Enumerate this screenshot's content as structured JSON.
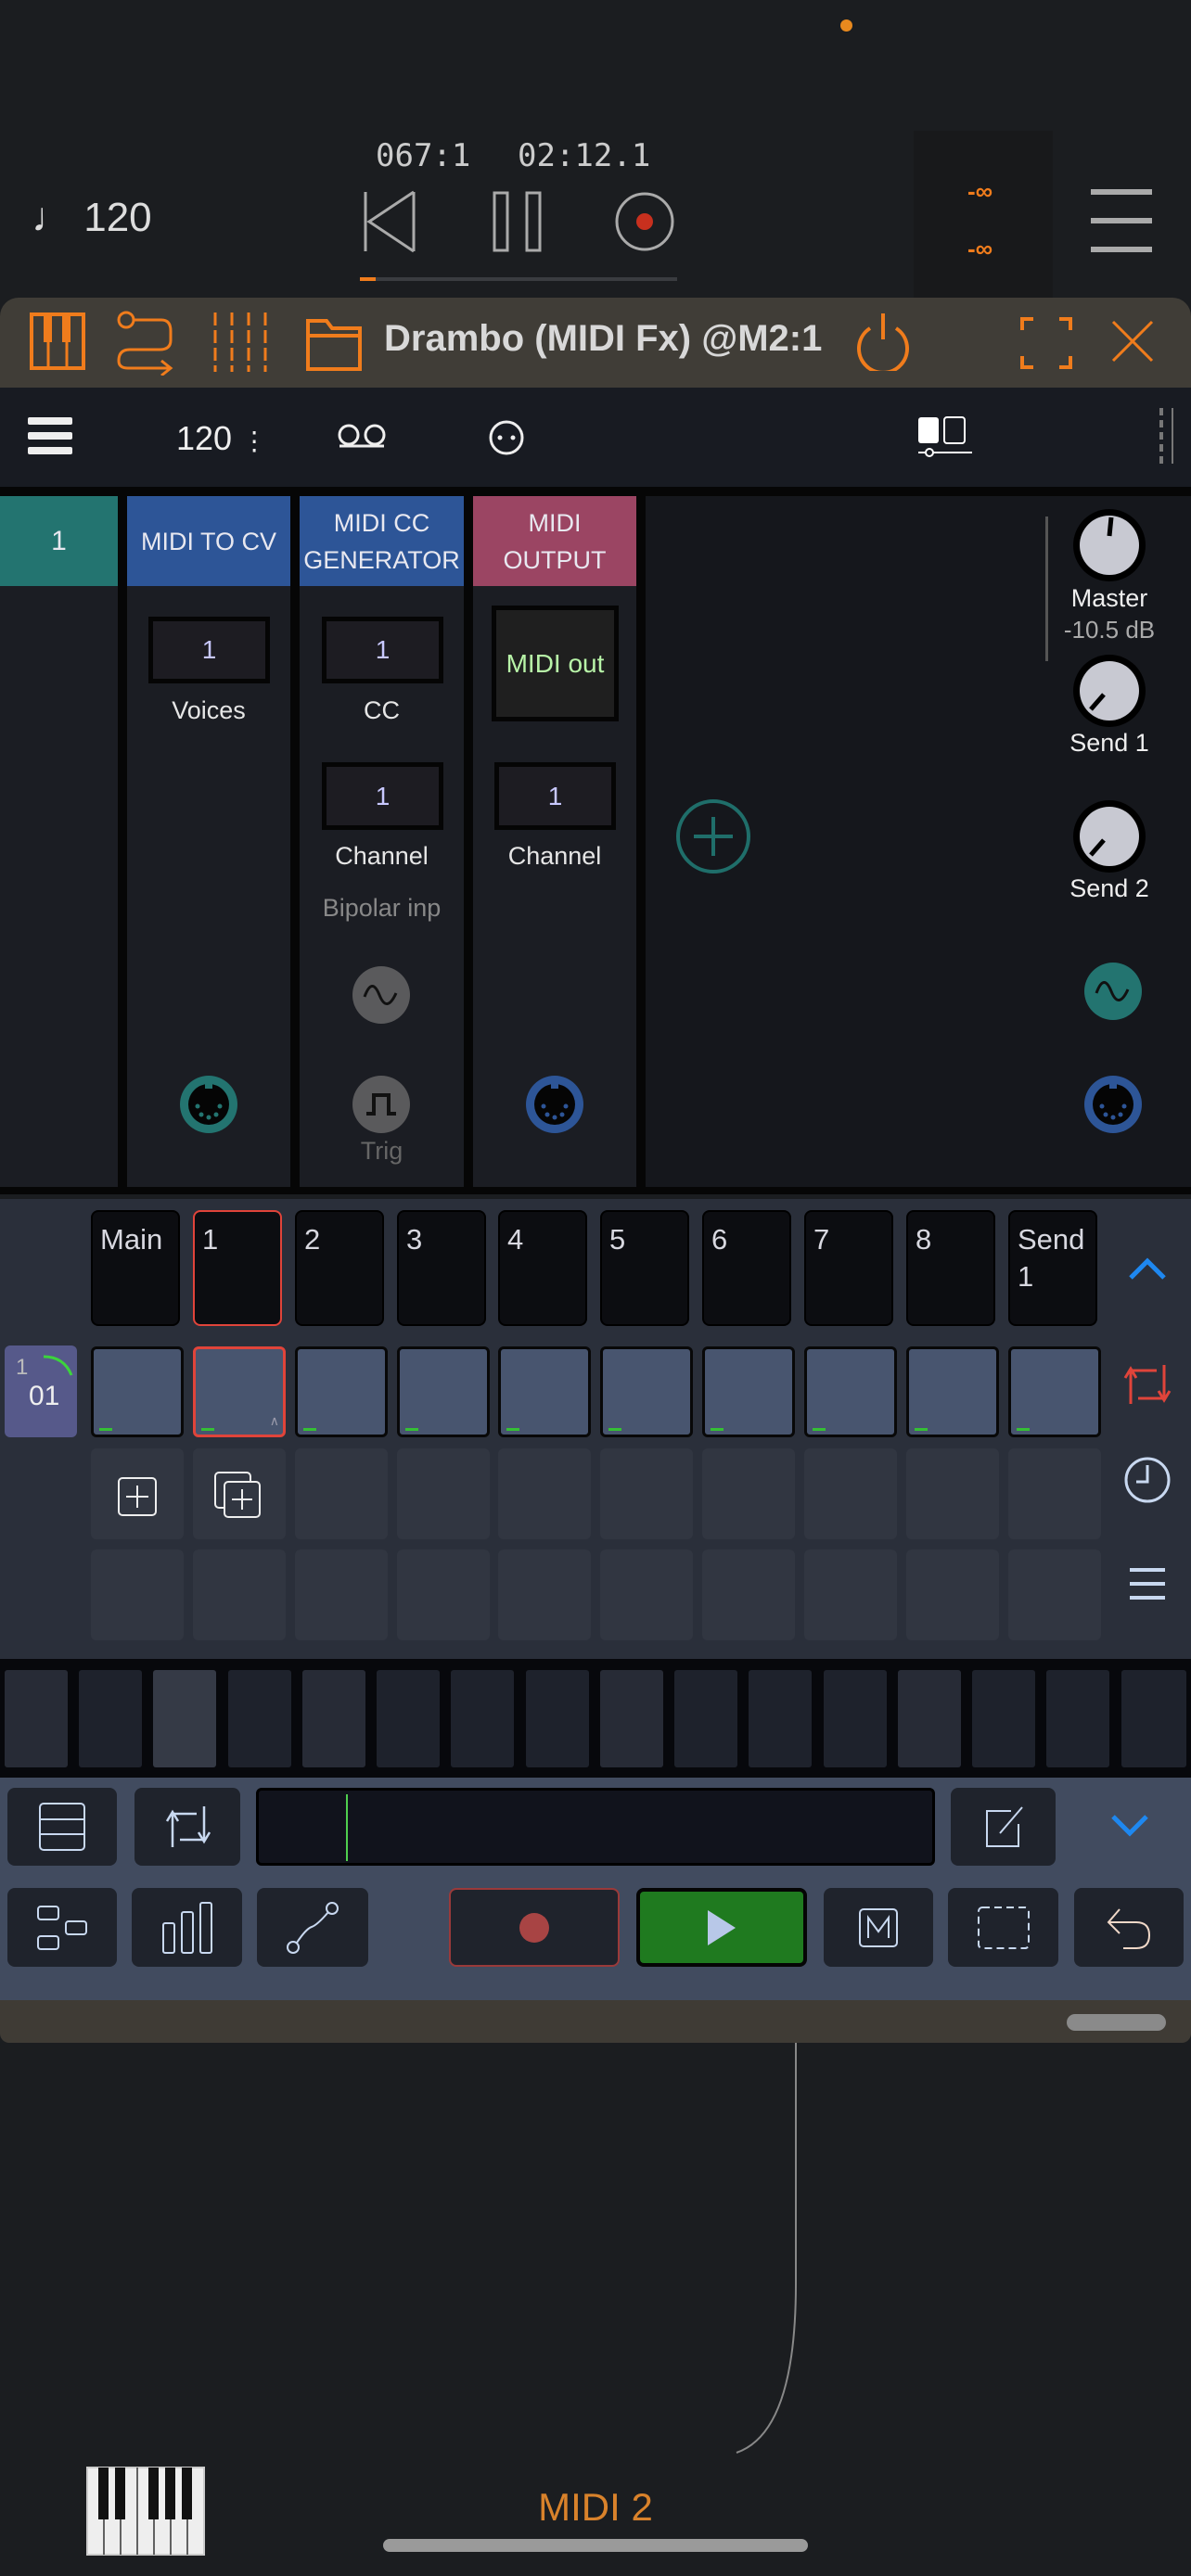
{
  "host": {
    "position": "067:1",
    "time": "02:12.1",
    "tempo": "120",
    "meter_left": "-∞",
    "meter_right": "-∞",
    "orange_dot_color": "#e8891e",
    "progress_percent": 5
  },
  "plugin": {
    "title": "Drambo (MIDI Fx) @M2:1",
    "accent": "#f07c1c"
  },
  "toolbar": {
    "tempo": "120"
  },
  "modules": [
    {
      "title": "1",
      "color": "#237470"
    },
    {
      "title": "MIDI TO CV",
      "color": "#2d5597",
      "params": [
        {
          "value": "1",
          "label": "Voices"
        }
      ]
    },
    {
      "title": "MIDI CC GENERATOR",
      "color": "#2d5597",
      "params": [
        {
          "value": "1",
          "label": "CC"
        },
        {
          "value": "1",
          "label": "Channel"
        }
      ],
      "extra": "Bipolar inp",
      "trig": "Trig"
    },
    {
      "title": "MIDI OUTPUT",
      "color": "#9b4563",
      "display": "MIDI out",
      "params": [
        {
          "value": "1",
          "label": "Channel"
        }
      ]
    }
  ],
  "mixer": {
    "master_label": "Master",
    "master_value": "-10.5 dB",
    "send1": "Send 1",
    "send2": "Send 2"
  },
  "tracks": [
    "Main",
    "1",
    "2",
    "3",
    "4",
    "5",
    "6",
    "7",
    "8",
    "Send 1"
  ],
  "selected_track": "1",
  "scene": {
    "number": "1",
    "name": "01"
  },
  "footer": {
    "label": "MIDI 2"
  }
}
